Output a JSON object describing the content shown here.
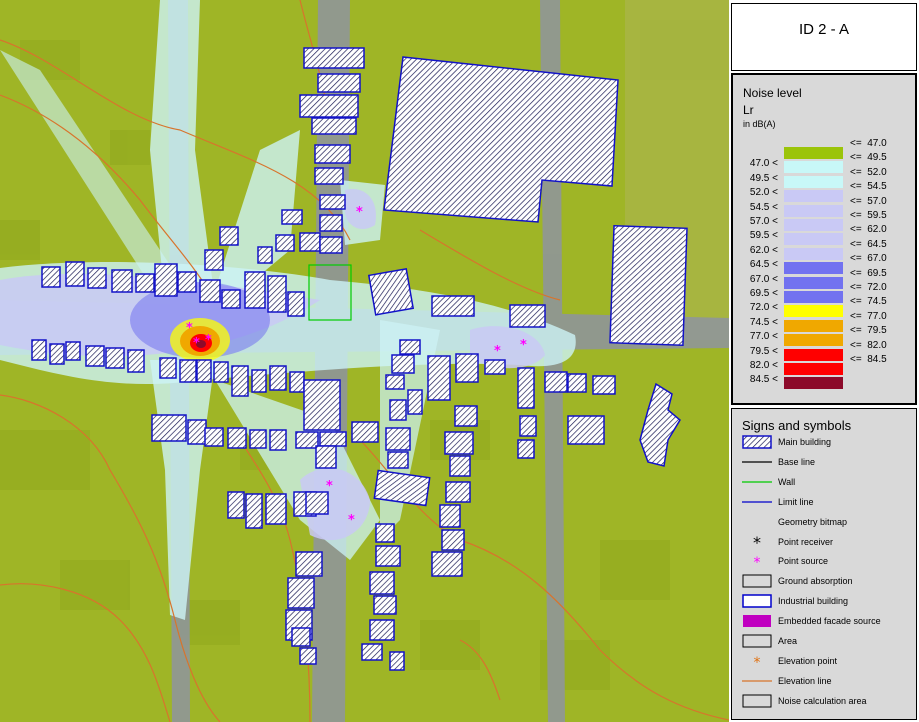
{
  "title": "ID 2 - A",
  "legend": {
    "title": "Noise level",
    "metric": "Lr",
    "unit": "in dB(A)",
    "rows": [
      {
        "low": "",
        "high": "<=  47.0",
        "color": "#9bc40a"
      },
      {
        "low": "47.0 <",
        "high": "<=  49.5",
        "color": "#c8f8f8"
      },
      {
        "low": "49.5 <",
        "high": "<=  52.0",
        "color": "#c8f8f8"
      },
      {
        "low": "52.0 <",
        "high": "<=  54.5",
        "color": "#c9c9f5"
      },
      {
        "low": "54.5 <",
        "high": "<=  57.0",
        "color": "#c9c9f5"
      },
      {
        "low": "57.0 <",
        "high": "<=  59.5",
        "color": "#c9c9f5"
      },
      {
        "low": "59.5 <",
        "high": "<=  62.0",
        "color": "#c9c9f5"
      },
      {
        "low": "62.0 <",
        "high": "<=  64.5",
        "color": "#c9c9f5"
      },
      {
        "low": "64.5 <",
        "high": "<=  67.0",
        "color": "#7272f0"
      },
      {
        "low": "67.0 <",
        "high": "<=  69.5",
        "color": "#7272f0"
      },
      {
        "low": "69.5 <",
        "high": "<=  72.0",
        "color": "#7272f0"
      },
      {
        "low": "72.0 <",
        "high": "<=  74.5",
        "color": "#ffff00"
      },
      {
        "low": "74.5 <",
        "high": "<=  77.0",
        "color": "#f0a800"
      },
      {
        "low": "77.0 <",
        "high": "<=  79.5",
        "color": "#f0a800"
      },
      {
        "low": "79.5 <",
        "high": "<=  82.0",
        "color": "#ff0000"
      },
      {
        "low": "82.0 <",
        "high": "<=  84.5",
        "color": "#ff0000"
      },
      {
        "low": "84.5 <",
        "high": "",
        "color": "#8c0a2a"
      }
    ]
  },
  "signs": {
    "title": "Signs and symbols",
    "items": [
      {
        "label": "Main building",
        "icon": "hatched-box"
      },
      {
        "label": "Base line",
        "icon": "black-line"
      },
      {
        "label": "Wall",
        "icon": "green-line"
      },
      {
        "label": "Limit line",
        "icon": "blue-line"
      },
      {
        "label": "Geometry bitmap",
        "icon": "none"
      },
      {
        "label": "Point receiver",
        "icon": "black-asterisk"
      },
      {
        "label": "Point source",
        "icon": "magenta-asterisk"
      },
      {
        "label": "Ground absorption",
        "icon": "gray-box"
      },
      {
        "label": "Industrial building",
        "icon": "white-box-blue-border"
      },
      {
        "label": "Embedded facade source",
        "icon": "magenta-box"
      },
      {
        "label": "Area",
        "icon": "gray-box"
      },
      {
        "label": "Elevation point",
        "icon": "orange-asterisk"
      },
      {
        "label": "Elevation line",
        "icon": "orange-line"
      },
      {
        "label": "Noise calculation area",
        "icon": "gray-box"
      }
    ]
  },
  "colors": {
    "map_base": "#9fb526",
    "road": "#8e94a0",
    "building_border": "#1212c8",
    "hatch": "#1a1a55",
    "elevation_line": "#d8742c",
    "point_source": "#ff00ff"
  }
}
